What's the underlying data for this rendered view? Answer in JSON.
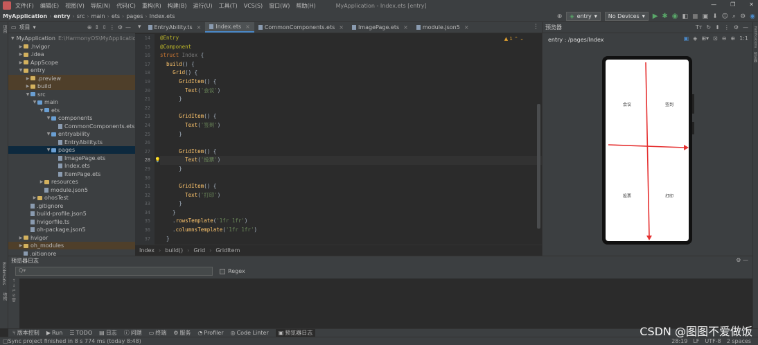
{
  "menubar": {
    "items": [
      "文件(F)",
      "编辑(E)",
      "视图(V)",
      "导航(N)",
      "代码(C)",
      "重构(R)",
      "构建(B)",
      "运行(U)",
      "工具(T)",
      "VCS(S)",
      "窗口(W)",
      "帮助(H)"
    ],
    "window_title": "MyApplication - Index.ets [entry]"
  },
  "navbar": {
    "crumbs": [
      "MyApplication",
      "entry",
      "src",
      "main",
      "ets",
      "pages",
      "Index.ets"
    ],
    "run_config": "entry",
    "device": "No Devices"
  },
  "project_panel": {
    "title": "项目",
    "tree": [
      {
        "label": "MyApplication",
        "extra": "E:\\HarmonyOS\\MyApplicatio",
        "depth": 0,
        "type": "folder",
        "open": true
      },
      {
        "label": ".hvigor",
        "depth": 1,
        "type": "folder",
        "open": false
      },
      {
        "label": ".idea",
        "depth": 1,
        "type": "folder",
        "open": false
      },
      {
        "label": "AppScope",
        "depth": 1,
        "type": "folder",
        "open": false
      },
      {
        "label": "entry",
        "depth": 1,
        "type": "folder",
        "open": true
      },
      {
        "label": ".preview",
        "depth": 2,
        "type": "folder",
        "open": false,
        "hl": "brown"
      },
      {
        "label": "build",
        "depth": 2,
        "type": "folder",
        "open": false,
        "hl": "brown"
      },
      {
        "label": "src",
        "depth": 2,
        "type": "folder",
        "open": true
      },
      {
        "label": "main",
        "depth": 3,
        "type": "folder",
        "open": true
      },
      {
        "label": "ets",
        "depth": 4,
        "type": "folder",
        "open": true
      },
      {
        "label": "components",
        "depth": 5,
        "type": "folder",
        "open": true
      },
      {
        "label": "CommonComponents.ets",
        "depth": 6,
        "type": "file"
      },
      {
        "label": "entryability",
        "depth": 5,
        "type": "folder",
        "open": true
      },
      {
        "label": "EntryAbility.ts",
        "depth": 6,
        "type": "file"
      },
      {
        "label": "pages",
        "depth": 5,
        "type": "folder",
        "open": true,
        "hl": "blue"
      },
      {
        "label": "ImagePage.ets",
        "depth": 6,
        "type": "file"
      },
      {
        "label": "Index.ets",
        "depth": 6,
        "type": "file"
      },
      {
        "label": "ItemPage.ets",
        "depth": 6,
        "type": "file"
      },
      {
        "label": "resources",
        "depth": 4,
        "type": "folder",
        "open": false
      },
      {
        "label": "module.json5",
        "depth": 4,
        "type": "file"
      },
      {
        "label": "ohosTest",
        "depth": 3,
        "type": "folder",
        "open": false
      },
      {
        "label": ".gitignore",
        "depth": 2,
        "type": "file"
      },
      {
        "label": "build-profile.json5",
        "depth": 2,
        "type": "file"
      },
      {
        "label": "hvigorfile.ts",
        "depth": 2,
        "type": "file"
      },
      {
        "label": "oh-package.json5",
        "depth": 2,
        "type": "file"
      },
      {
        "label": "hvigor",
        "depth": 1,
        "type": "folder",
        "open": false
      },
      {
        "label": "oh_modules",
        "depth": 1,
        "type": "folder",
        "open": false,
        "hl": "brown"
      },
      {
        "label": ".gitignore",
        "depth": 1,
        "type": "file"
      }
    ]
  },
  "editor": {
    "tabs": [
      {
        "label": "EntryAbility.ts",
        "active": false
      },
      {
        "label": "Index.ets",
        "active": true
      },
      {
        "label": "CommonComponents.ets",
        "active": false
      },
      {
        "label": "ImagePage.ets",
        "active": false
      },
      {
        "label": "module.json5",
        "active": false
      }
    ],
    "warning_count": "1",
    "current_line": 28,
    "lines": [
      {
        "n": 14,
        "html": "<span class=\"dec\">@Entry</span>"
      },
      {
        "n": 15,
        "html": "<span class=\"dec\">@Component</span>"
      },
      {
        "n": 16,
        "html": "<span class=\"kw\">struct</span> <span class=\"fade\">Index</span> {"
      },
      {
        "n": 17,
        "html": "  <span class=\"fn\">build</span>() {"
      },
      {
        "n": 18,
        "html": "    <span class=\"fn\">Grid</span>() {"
      },
      {
        "n": 19,
        "html": "      <span class=\"fn\">GridItem</span>() {"
      },
      {
        "n": 20,
        "html": "        <span class=\"fn\">Text</span>(<span class=\"str\">'会议'</span>)"
      },
      {
        "n": 21,
        "html": "      }"
      },
      {
        "n": 22,
        "html": ""
      },
      {
        "n": 23,
        "html": "      <span class=\"fn\">GridItem</span>() {"
      },
      {
        "n": 24,
        "html": "        <span class=\"fn\">Text</span>(<span class=\"str\">'签到'</span>)"
      },
      {
        "n": 25,
        "html": "      }"
      },
      {
        "n": 26,
        "html": ""
      },
      {
        "n": 27,
        "html": "      <span class=\"fn\">GridItem</span>() {"
      },
      {
        "n": 28,
        "html": "        <span class=\"fn\">Text</span>(<span class=\"str\">'投票'</span>)"
      },
      {
        "n": 29,
        "html": "      }"
      },
      {
        "n": 30,
        "html": ""
      },
      {
        "n": 31,
        "html": "      <span class=\"fn\">GridItem</span>() {"
      },
      {
        "n": 32,
        "html": "        <span class=\"fn\">Text</span>(<span class=\"str\">'打印'</span>)"
      },
      {
        "n": 33,
        "html": "      }"
      },
      {
        "n": 34,
        "html": "    }"
      },
      {
        "n": 35,
        "html": "    .<span class=\"fn\">rowsTemplate</span>(<span class=\"str\">'1fr 1fr'</span>)"
      },
      {
        "n": 36,
        "html": "    .<span class=\"fn\">columnsTemplate</span>(<span class=\"str\">'1fr 1fr'</span>)"
      },
      {
        "n": 37,
        "html": "  }"
      }
    ],
    "breadcrumb": [
      "Index",
      "build()",
      "Grid",
      "GridItem"
    ]
  },
  "preview": {
    "title": "预览器",
    "page_path": "entry : /pages/Index",
    "grid": [
      "会议",
      "签到",
      "投票",
      "打印"
    ]
  },
  "bottom_panel": {
    "title": "预览器日志",
    "search_placeholder": "Q▾",
    "regex_label": "Regex"
  },
  "toolwindows": [
    "版本控制",
    "Run",
    "TODO",
    "日志",
    "问题",
    "终端",
    "服务",
    "Profiler",
    "Code Linter",
    "预览器日志"
  ],
  "left_vertical": [
    "项目",
    "Bookmarks",
    "结构"
  ],
  "right_vertical": [
    "Notifications",
    "预览器"
  ],
  "status": {
    "message": "Sync project finished in 8 s 774 ms (today 8:48)",
    "position": "28:19",
    "line_sep": "LF",
    "encoding": "UTF-8",
    "indent": "2 spaces"
  },
  "watermark": "CSDN @图图不爱做饭"
}
